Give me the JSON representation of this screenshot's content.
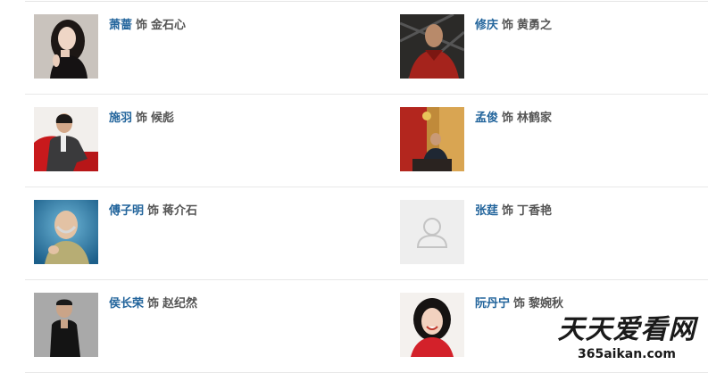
{
  "as_word": "饰",
  "cast": [
    {
      "actor": "萧蔷",
      "role": "金石心",
      "photo": "portrait-woman-dark-hair-icon"
    },
    {
      "actor": "修庆",
      "role": "黄勇之",
      "photo": "portrait-man-red-jacket-icon"
    },
    {
      "actor": "施羽",
      "role": "候彪",
      "photo": "portrait-man-red-chair-icon"
    },
    {
      "actor": "孟俊",
      "role": "林鹤家",
      "photo": "portrait-man-uniform-flag-icon"
    },
    {
      "actor": "傅子明",
      "role": "蒋介石",
      "photo": "portrait-man-bald-blue-icon"
    },
    {
      "actor": "张莛",
      "role": "丁香艳",
      "photo": "avatar-placeholder-icon"
    },
    {
      "actor": "侯长荣",
      "role": "赵纪然",
      "photo": "portrait-man-black-suit-icon"
    },
    {
      "actor": "阮丹宁",
      "role": "黎婉秋",
      "photo": "portrait-woman-smiling-icon"
    }
  ],
  "watermark": {
    "title": "天天爱看网",
    "url": "365aikan.com"
  },
  "colors": {
    "actor_link": "#23659c",
    "role_text": "#555555",
    "divider": "#e8e8e8"
  }
}
